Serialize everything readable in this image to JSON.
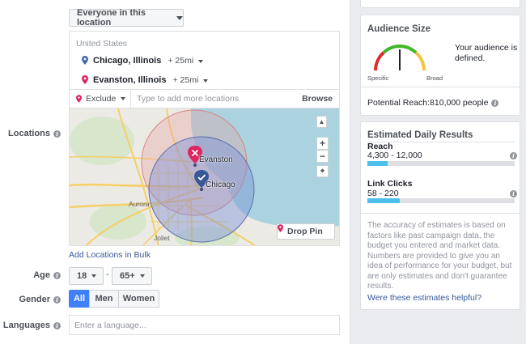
{
  "locations": {
    "location_type": "Everyone in this location",
    "country": "United States",
    "items": [
      {
        "name": "Chicago, Illinois",
        "radius": "+ 25mi",
        "pin_color": "#4267b2"
      },
      {
        "name": "Evanston, Illinois",
        "radius": "+ 25mi",
        "pin_color": "#e0245e"
      }
    ],
    "include_mode": "Exclude",
    "input_placeholder": "Type to add more locations",
    "browse_label": "Browse",
    "bulk_link": "Add Locations in Bulk"
  },
  "map": {
    "labels": {
      "evanston": "Evanston",
      "chicago": "Chicago",
      "aurora": "Aurora",
      "joliet": "Joliet"
    },
    "zoom_in": "+",
    "zoom_out": "−",
    "drop_pin_label": "Drop Pin"
  },
  "labels": {
    "locations": "Locations",
    "age": "Age",
    "gender": "Gender",
    "languages": "Languages"
  },
  "age": {
    "min": "18",
    "max": "65+",
    "separator": "-"
  },
  "gender": {
    "options": [
      "All",
      "Men",
      "Women"
    ],
    "selected": "All"
  },
  "languages": {
    "placeholder": "Enter a language..."
  },
  "audience": {
    "title": "Audience Size",
    "description": "Your audience is defined.",
    "gauge_low": "Specific",
    "gauge_high": "Broad",
    "gauge_level": 0.5,
    "potential_reach": "Potential Reach:810,000 people"
  },
  "estimates": {
    "title": "Estimated Daily Results",
    "reach": {
      "label": "Reach",
      "range": "4,300 - 12,000",
      "bar_fraction": 0.14
    },
    "clicks": {
      "label": "Link Clicks",
      "range": "58 - 220",
      "bar_fraction": 0.22
    },
    "description": "The accuracy of estimates is based on factors like past campaign data, the budget you entered and market data. Numbers are provided to give you an idea of performance for your budget, but are only estimates and don't guarantee results.",
    "link": "Were these estimates helpful?"
  },
  "colors": {
    "accent": "#4080ff",
    "link": "#365899",
    "bar_fill": "#4cc0ec"
  }
}
